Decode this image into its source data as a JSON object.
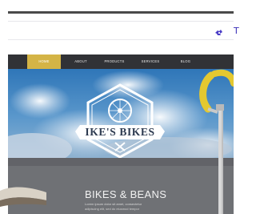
{
  "browser": {
    "menu_letter": "T",
    "accent_color": "#3a2fb8",
    "icon_name": "puzzle-extension-icon"
  },
  "site": {
    "nav": {
      "items": [
        {
          "label": "HOME",
          "active": true
        },
        {
          "label": "ABOUT",
          "active": false
        },
        {
          "label": "PRODUCTS",
          "active": false
        },
        {
          "label": "SERVICES",
          "active": false
        },
        {
          "label": "BLOG",
          "active": false
        }
      ],
      "active_color": "#d4b446",
      "bar_color": "#313236"
    },
    "logo": {
      "title": "IKE'S BIKES"
    },
    "band": {
      "title": "BIKES & BEANS",
      "text_line1": "Lorem ipsum dolor sit amet, consectetur",
      "text_line2": "adipiscing elit, sed do eiusmod tempor"
    }
  }
}
